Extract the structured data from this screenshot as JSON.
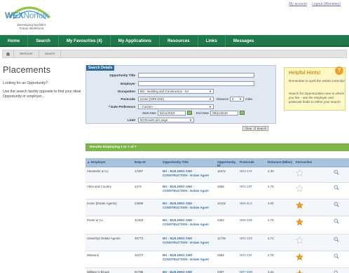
{
  "header": {
    "logo": {
      "brand_a": "WEX",
      "brand_b": "Norfolk",
      "tagline_1": "Developing Norfolk's",
      "tagline_2": "Future Workforce"
    },
    "top_links": [
      "My account",
      "Logout (Wonsbey)"
    ]
  },
  "nav": {
    "items": [
      "Home",
      "Search",
      "My Favourites (4)",
      "My Applications",
      "Resources",
      "Links",
      "Messages"
    ]
  },
  "breadcrumb": {
    "items": [
      "Welcome",
      "Search"
    ]
  },
  "page": {
    "title": "Placements",
    "question": "Looking for an Opportunity?",
    "text": "Use the search facility opposite to find your ideal Opportunity or employer..."
  },
  "search": {
    "tab": "Search Details",
    "fields": {
      "opportunity_title": {
        "label": "Opportunity Title",
        "value": ""
      },
      "employer": {
        "label": "Employer",
        "value": ""
      },
      "occupation": {
        "label": "Occupation",
        "value": "BG - Building and Construction - Es"
      },
      "postcode": {
        "label": "Postcode",
        "value": "Home (NR6 5SE)",
        "distance_label": "Distance",
        "distance_value": "5",
        "distance_unit": "miles"
      },
      "date_preference": {
        "label": "* Date Preference",
        "value": "- Custom -"
      },
      "dates": {
        "start_label": "Start Date",
        "start_value": "04/11/2018",
        "end_label": "End Date",
        "end_value": "09/11/2018"
      },
      "limit": {
        "label": "Limit",
        "value": "50 Results per page"
      }
    },
    "buttons": {
      "clear": "Clear",
      "search": "Search"
    }
  },
  "hints": {
    "title": "Helpful Hints!",
    "icon": "?",
    "p1": "Remember to spell the words correctly!",
    "p2": "Search for Opportunities near to where you live - use the employer and postcode fields to refine your search"
  },
  "results": {
    "heading": "Results Displaying 1 to 7 of 7",
    "columns": [
      "Employer",
      "Emp ID",
      "Opportunity Title",
      "Opportunity ID",
      "Postcode",
      "Distance (Miles)",
      "Favourites"
    ],
    "rows": [
      {
        "employer": "Alexander & Co",
        "emp_id": "17467",
        "title": "BG - BUILDING AND CONSTRUCTION - Estate Agent",
        "opp_id": "11572",
        "postcode": "NR3 4AF",
        "distance": "2.30",
        "favourite": false
      },
      {
        "employer": "Aties and Country",
        "emp_id": "2272",
        "title": "BG - BUILDING AND CONSTRUCTION - Estate Agent",
        "opp_id": "2656",
        "postcode": "NR4 4SF",
        "distance": "2.75",
        "favourite": false
      },
      {
        "employer": "Iconic (Estate Agents)",
        "emp_id": "23089",
        "title": "BG - BUILDING AND CONSTRUCTION - Estate Agent",
        "opp_id": "10102",
        "postcode": "NR6 6LS",
        "distance": "3.04",
        "favourite": true
      },
      {
        "employer": "Porter & Co",
        "emp_id": "31303",
        "title": "BG - BUILDING AND CONSTRUCTION - Estate Agent",
        "opp_id": "2452",
        "postcode": "NR6 4SE",
        "distance": "2.75",
        "favourite": true
      },
      {
        "employer": "Sowerbys Estate Agents",
        "emp_id": "45773",
        "title": "BG - BUILDING AND CONSTRUCTION - Estate Agent",
        "opp_id": "11736",
        "postcode": "NR2 4SX",
        "distance": "2.71",
        "favourite": false
      },
      {
        "employer": "Watsons",
        "emp_id": "31372",
        "title": "BG - BUILDING AND CONSTRUCTION - Estate Agent",
        "opp_id": "2565",
        "postcode": "NR2 4SF",
        "distance": "2.75",
        "favourite": true
      },
      {
        "employer": "William H Brown",
        "emp_id": "51798",
        "title": "BG - BUILDING AND CONSTRUCTION - Estate",
        "opp_id": "2307",
        "postcode": "NR7 5SR",
        "distance": "2.31",
        "favourite": true
      }
    ]
  },
  "colors": {
    "nav_bg": "#1f7a4b",
    "results_bar": "#7fb64a",
    "table_header": "#a9c3dc",
    "search_tab": "#2e6aa0",
    "hints_bg": "#fff7c4",
    "star_on": "#f0a020"
  }
}
